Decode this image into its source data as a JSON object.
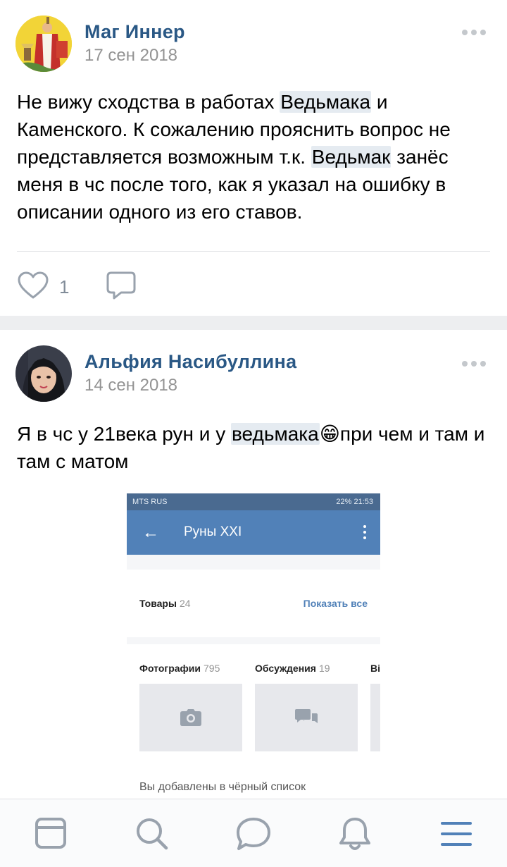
{
  "posts": [
    {
      "author": "Маг Иннер",
      "date": "17 сен 2018",
      "text_parts": [
        "Не вижу сходства в работах ",
        "Ведьмака",
        " и Каменского. К сожалению прояснить вопрос не представляется возможным т.к. ",
        "Ведьмак",
        " занёс меня в чс после того, как я указал на ошибку в описании одного из его ставов."
      ],
      "likes": "1"
    },
    {
      "author": "Альфия Насибуллина",
      "date": "14 сен 2018",
      "text_parts": [
        "Я в чс у 21века рун и у ",
        "ведьмака",
        "😁",
        "при чем и там и там с матом"
      ]
    }
  ],
  "embedded_screenshot": {
    "status_left": "MTS RUS",
    "status_right": "22% 21:53",
    "header_title": "Руны  XXI",
    "goods_label": "Товары",
    "goods_count": "24",
    "show_all": "Показать все",
    "photos_label": "Фотографии",
    "photos_count": "795",
    "discussions_label": "Обсуждения",
    "discussions_count": "19",
    "cut_label": "Ві",
    "blacklist_notice": "Вы добавлены в чёрный список"
  },
  "icons": {
    "like": "heart-icon",
    "comment": "comment-icon",
    "more": "more-dots-icon",
    "tabs": [
      "news-icon",
      "search-icon",
      "messages-icon",
      "notifications-icon",
      "menu-icon"
    ]
  },
  "colors": {
    "author": "#2a5885",
    "accent": "#5181b8",
    "highlight": "#e5ebf1",
    "icon_gray": "#99a2ad"
  }
}
